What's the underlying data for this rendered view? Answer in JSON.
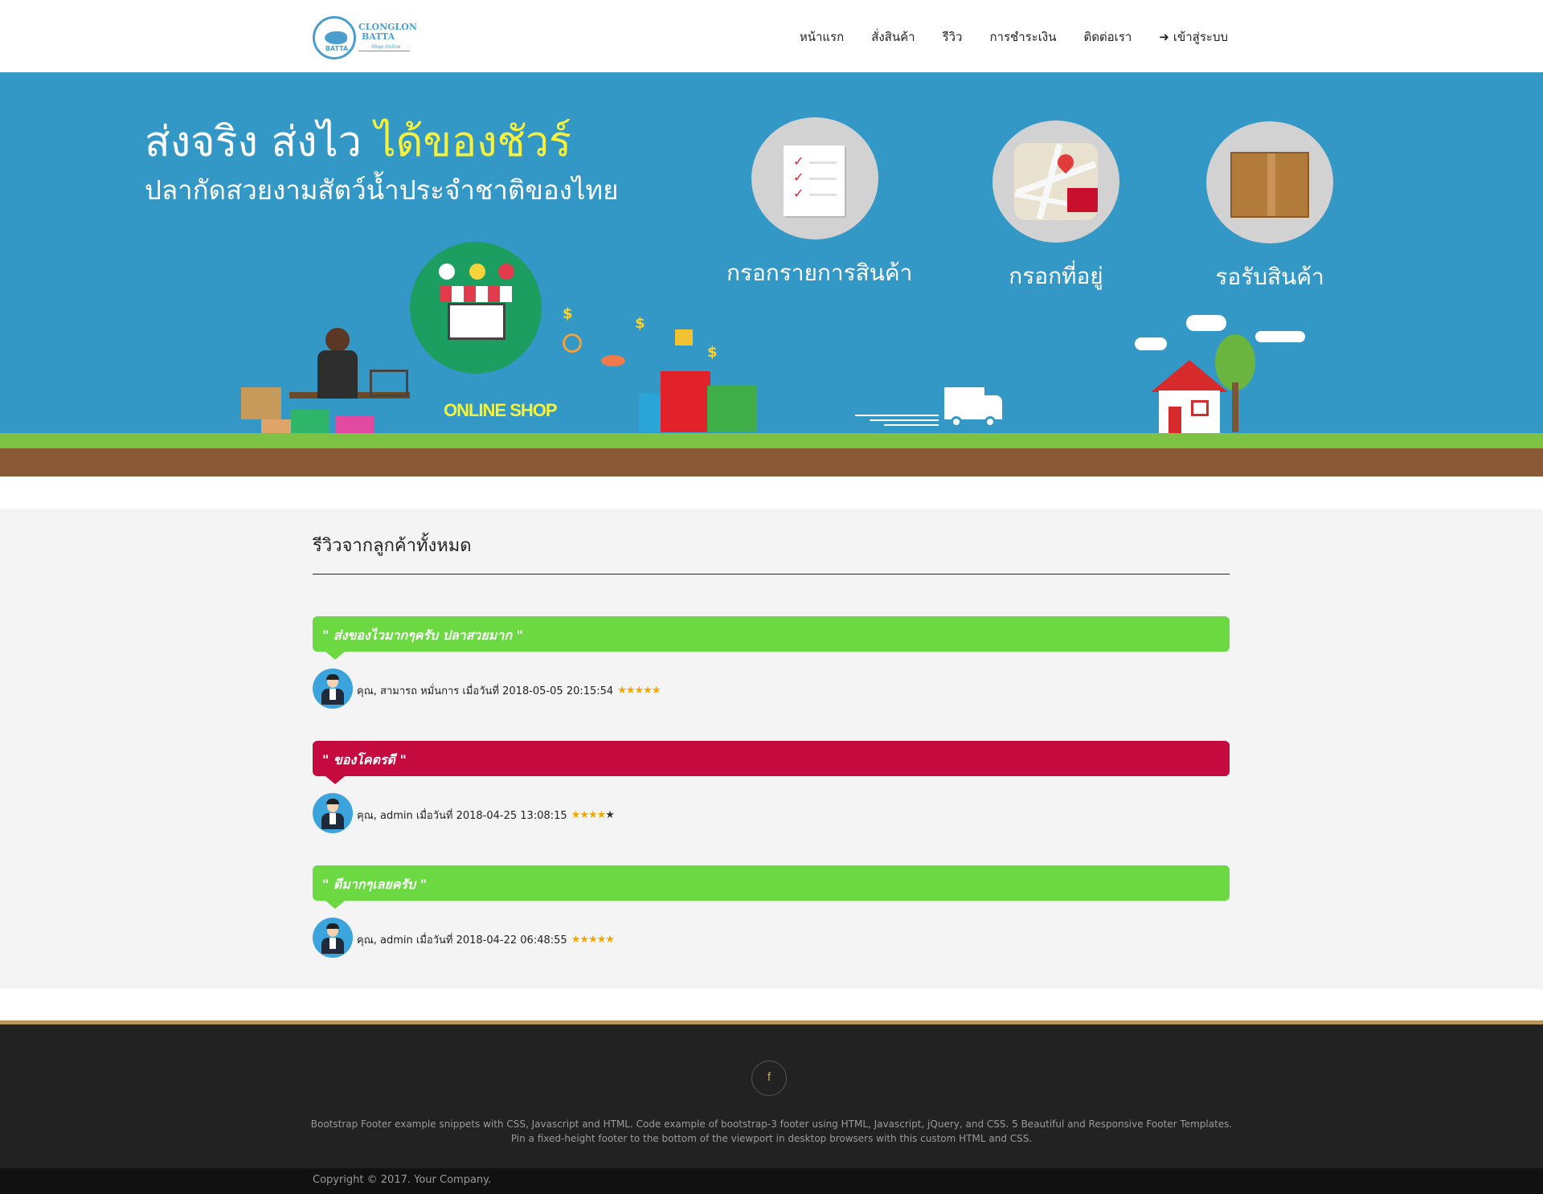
{
  "brand": {
    "line1": "CLONGLON",
    "line2": "BATTA",
    "badge": "BATTA",
    "tagline": "Shop Online"
  },
  "nav": {
    "items": [
      "หน้าแรก",
      "สั่งสินค้า",
      "รีวิว",
      "การชำระเงิน",
      "ติดต่อเรา"
    ],
    "login": "เข้าสู่ระบบ"
  },
  "hero": {
    "headline_part1": "ส่งจริง ส่งไว ",
    "headline_highlight": "ได้ของชัวร์",
    "subheadline": "ปลากัดสวยงามสัตว์น้ำประจำชาติของไทย",
    "steps": [
      "กรอกรายการสินค้า",
      "กรอกที่อยู่",
      "รอรับสินค้า"
    ],
    "art_text": {
      "online_shop": "ONLINE SHOP"
    },
    "carousel": {
      "count": 2,
      "active": 0
    },
    "colors": {
      "background": "#3498c6",
      "highlight": "#f6f13b",
      "grass": "#7dc242",
      "soil": "#8a5a36"
    }
  },
  "reviews": {
    "title": "รีวิวจากลูกค้าทั้งหมด",
    "items": [
      {
        "quote": "\" ส่งของไวมากๆครับ ปลาสวยมาก \"",
        "meta": "คุณ, สามารถ หมั่นการ เมื่อวันที่ 2018-05-05 20:15:54",
        "rating": 5,
        "color": "#6cd943"
      },
      {
        "quote": "\" ของโคตรดี \"",
        "meta": "คุณ, admin เมื่อวันที่ 2018-04-25 13:08:15",
        "rating": 4,
        "color": "#c40a3f"
      },
      {
        "quote": "\" ดีมากๆเลยครับ \"",
        "meta": "คุณ, admin เมื่อวันที่ 2018-04-22 06:48:55",
        "rating": 5,
        "color": "#6cd943"
      }
    ],
    "max_rating": 5
  },
  "footer": {
    "social_icon": "f",
    "text_line1": "Bootstrap Footer example snippets with CSS, Javascript and HTML. Code example of bootstrap-3 footer using HTML, Javascript, jQuery, and CSS. 5 Beautiful and Responsive Footer Templates.",
    "text_line2": "Pin a fixed-height footer to the bottom of the viewport in desktop browsers with this custom HTML and CSS.",
    "copyright": "Copyright © 2017. Your Company."
  },
  "icons": {
    "login": "sign-in-icon",
    "facebook": "facebook-icon",
    "star": "star-icon"
  }
}
